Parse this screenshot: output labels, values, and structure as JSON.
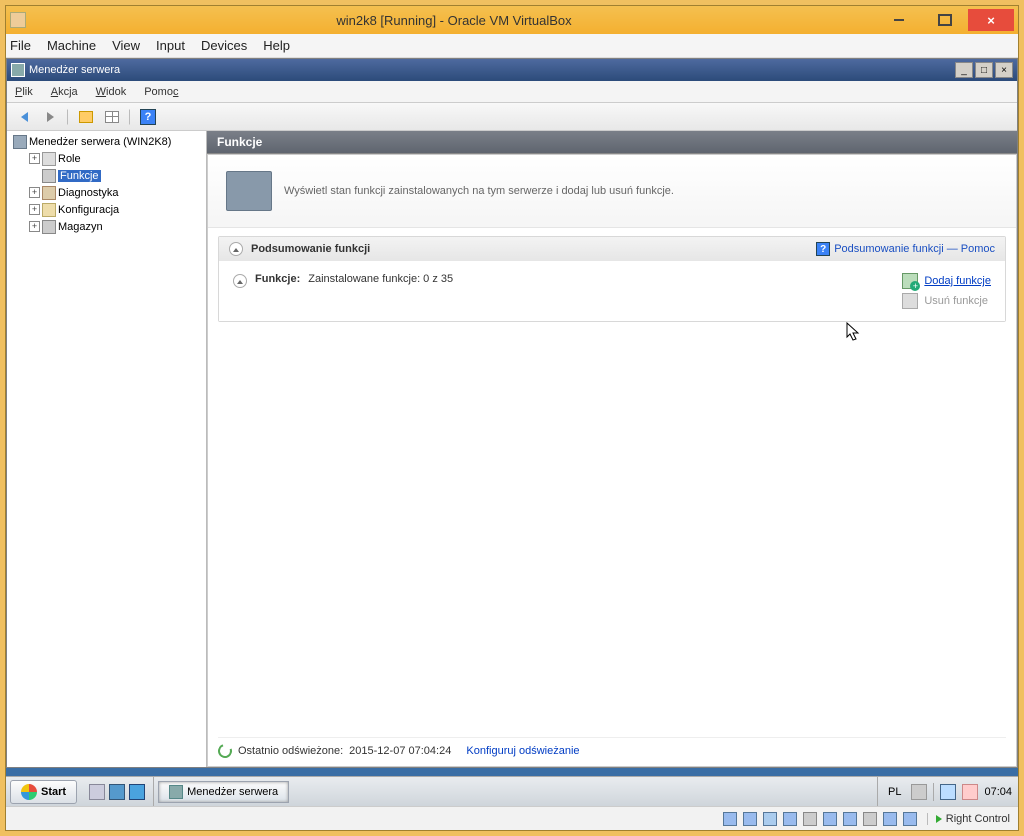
{
  "vb": {
    "title": "win2k8 [Running] - Oracle VM VirtualBox",
    "menu": {
      "file": "File",
      "machine": "Machine",
      "view": "View",
      "input": "Input",
      "devices": "Devices",
      "help": "Help"
    },
    "hostkey": "Right Control"
  },
  "sm": {
    "title": "Menedżer serwera",
    "menu": {
      "file": "Plik",
      "action": "Akcja",
      "view": "Widok",
      "help": "Pomoc"
    },
    "tree": {
      "root": "Menedżer serwera (WIN2K8)",
      "role": "Role",
      "features": "Funkcje",
      "diag": "Diagnostyka",
      "config": "Konfiguracja",
      "storage": "Magazyn"
    },
    "content": {
      "header": "Funkcje",
      "intro": "Wyświetl stan funkcji zainstalowanych na tym serwerze i dodaj lub usuń funkcje.",
      "summary_title": "Podsumowanie funkcji",
      "summary_help": "Podsumowanie funkcji — Pomoc",
      "features_label": "Funkcje:",
      "features_text": "Zainstalowane funkcje: 0 z 35",
      "add_features": "Dodaj funkcje",
      "remove_features": "Usuń funkcje",
      "refresh_prefix": "Ostatnio odświeżone:",
      "refresh_time": "2015-12-07 07:04:24",
      "refresh_config": "Konfiguruj odświeżanie"
    }
  },
  "taskbar": {
    "start": "Start",
    "app": "Menedżer serwera",
    "lang": "PL",
    "clock": "07:04"
  }
}
